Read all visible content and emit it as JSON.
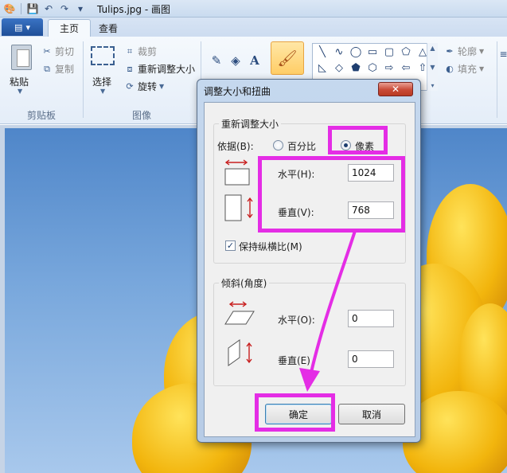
{
  "window": {
    "title": "Tulips.jpg - 画图"
  },
  "quick_access": {
    "icons": [
      "paint-app-icon",
      "save-icon",
      "undo-icon",
      "redo-icon",
      "customize-dropdown-icon"
    ]
  },
  "tabs": {
    "home": "主页",
    "view": "查看"
  },
  "ribbon": {
    "clipboard": {
      "paste": "粘贴",
      "cut": "剪切",
      "copy": "复制",
      "group": "剪贴板"
    },
    "image": {
      "select": "选择",
      "crop": "裁剪",
      "resize": "重新调整大小",
      "rotate": "旋转",
      "group": "图像"
    },
    "brushes": "刷子",
    "outline": "轮廓",
    "fill": "填充"
  },
  "dialog": {
    "title": "调整大小和扭曲",
    "close_label": "✕",
    "resize": {
      "legend": "重新调整大小",
      "by_label": "依据(B):",
      "percent": "百分比",
      "pixels": "像素",
      "selected": "pixels",
      "horizontal_label": "水平(H):",
      "horizontal_value": "1024",
      "vertical_label": "垂直(V):",
      "vertical_value": "768",
      "keep_ratio": "保持纵横比(M)",
      "keep_ratio_checked": true
    },
    "skew": {
      "legend": "倾斜(角度)",
      "horizontal_label": "水平(O):",
      "horizontal_value": "0",
      "vertical_label": "垂直(E)",
      "vertical_value": "0"
    },
    "ok": "确定",
    "cancel": "取消"
  },
  "colors": {
    "highlight": "#e42de5",
    "accent": "#1f4f98"
  }
}
